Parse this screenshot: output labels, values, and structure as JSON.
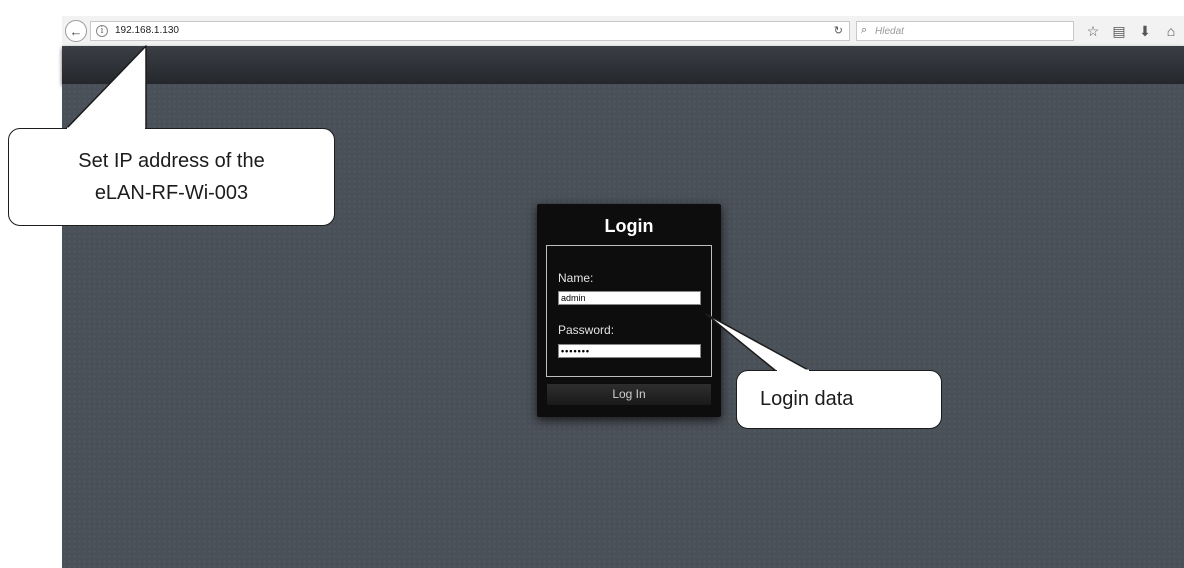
{
  "browser": {
    "url": "192.168.1.130",
    "search_placeholder": "Hledat",
    "icons": [
      "back-arrow-icon",
      "info-icon",
      "reload-icon",
      "search-icon",
      "bookmark-star-icon",
      "reading-list-icon",
      "downloads-icon",
      "home-icon",
      "pocket-icon",
      "menu-icon"
    ]
  },
  "login": {
    "title": "Login",
    "name_label": "Name:",
    "name_value": "admin",
    "password_label": "Password:",
    "password_value": "•••••••",
    "button_label": "Log In"
  },
  "callouts": {
    "ip_line1": "Set IP address of the",
    "ip_line2": "eLAN-RF-Wi-003",
    "login_data": "Login data"
  },
  "colors": {
    "page_background": "#4a5058",
    "login_box": "#0d0d0d",
    "callout_border": "#1c1c1c"
  }
}
